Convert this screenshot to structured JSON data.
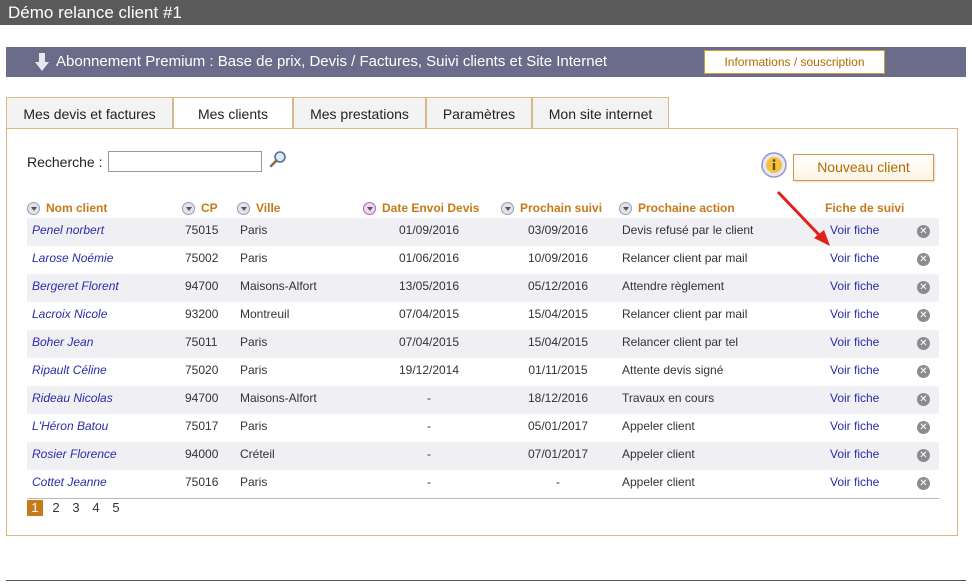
{
  "window": {
    "title": "Démo relance client #1"
  },
  "promo": {
    "text": "Abonnement Premium : Base de prix, Devis / Factures, Suivi clients et Site Internet",
    "button_label": "Informations / souscription"
  },
  "tabs": [
    {
      "label": "Mes devis et factures",
      "active": false
    },
    {
      "label": "Mes clients",
      "active": true
    },
    {
      "label": "Mes prestations",
      "active": false
    },
    {
      "label": "Paramètres",
      "active": false
    },
    {
      "label": "Mon site internet",
      "active": false
    }
  ],
  "search": {
    "label": "Recherche :",
    "value": "",
    "placeholder": ""
  },
  "actions": {
    "new_client_label": "Nouveau client"
  },
  "table": {
    "headers": {
      "nom": "Nom client",
      "cp": "CP",
      "ville": "Ville",
      "date_envoi": "Date Envoi Devis",
      "prochain": "Prochain suivi",
      "action": "Prochaine action",
      "fiche": "Fiche de suivi"
    },
    "rows": [
      {
        "nom": "Penel norbert",
        "cp": "75015",
        "ville": "Paris",
        "date_envoi": "01/09/2016",
        "prochain": "03/09/2016",
        "action": "Devis refusé par le client",
        "fiche": "Voir fiche"
      },
      {
        "nom": "Larose Noémie",
        "cp": "75002",
        "ville": "Paris",
        "date_envoi": "01/06/2016",
        "prochain": "10/09/2016",
        "action": "Relancer client par mail",
        "fiche": "Voir fiche"
      },
      {
        "nom": "Bergeret Florent",
        "cp": "94700",
        "ville": "Maisons-Alfort",
        "date_envoi": "13/05/2016",
        "prochain": "05/12/2016",
        "action": "Attendre règlement",
        "fiche": "Voir fiche"
      },
      {
        "nom": "Lacroix Nicole",
        "cp": "93200",
        "ville": "Montreuil",
        "date_envoi": "07/04/2015",
        "prochain": "15/04/2015",
        "action": "Relancer client par mail",
        "fiche": "Voir fiche"
      },
      {
        "nom": "Boher Jean",
        "cp": "75011",
        "ville": "Paris",
        "date_envoi": "07/04/2015",
        "prochain": "15/04/2015",
        "action": "Relancer client par tel",
        "fiche": "Voir fiche"
      },
      {
        "nom": "Ripault Céline",
        "cp": "75020",
        "ville": "Paris",
        "date_envoi": "19/12/2014",
        "prochain": "01/11/2015",
        "action": "Attente devis signé",
        "fiche": "Voir fiche"
      },
      {
        "nom": "Rideau Nicolas",
        "cp": "94700",
        "ville": "Maisons-Alfort",
        "date_envoi": "-",
        "prochain": "18/12/2016",
        "action": "Travaux en cours",
        "fiche": "Voir fiche"
      },
      {
        "nom": "L'Héron Batou",
        "cp": "75017",
        "ville": "Paris",
        "date_envoi": "-",
        "prochain": "05/01/2017",
        "action": "Appeler client",
        "fiche": "Voir fiche"
      },
      {
        "nom": "Rosier Florence",
        "cp": "94000",
        "ville": "Créteil",
        "date_envoi": "-",
        "prochain": "07/01/2017",
        "action": "Appeler client",
        "fiche": "Voir fiche"
      },
      {
        "nom": "Cottet Jeanne",
        "cp": "75016",
        "ville": "Paris",
        "date_envoi": "-",
        "prochain": "-",
        "action": "Appeler client",
        "fiche": "Voir fiche"
      }
    ]
  },
  "pagination": {
    "pages": [
      "1",
      "2",
      "3",
      "4",
      "5"
    ],
    "current": "1"
  },
  "colors": {
    "accent": "#c77a1a",
    "link": "#2c2ca8",
    "promo_bg": "#6b6b8a",
    "titlebar_bg": "#5a5a5a",
    "annotation": "#e0201a"
  },
  "icons": {
    "promo": "download-arrow-icon",
    "search": "magnifier-icon",
    "help": "info-icon",
    "row_delete": "close-circle-icon",
    "annotation": "red-arrow-icon"
  }
}
